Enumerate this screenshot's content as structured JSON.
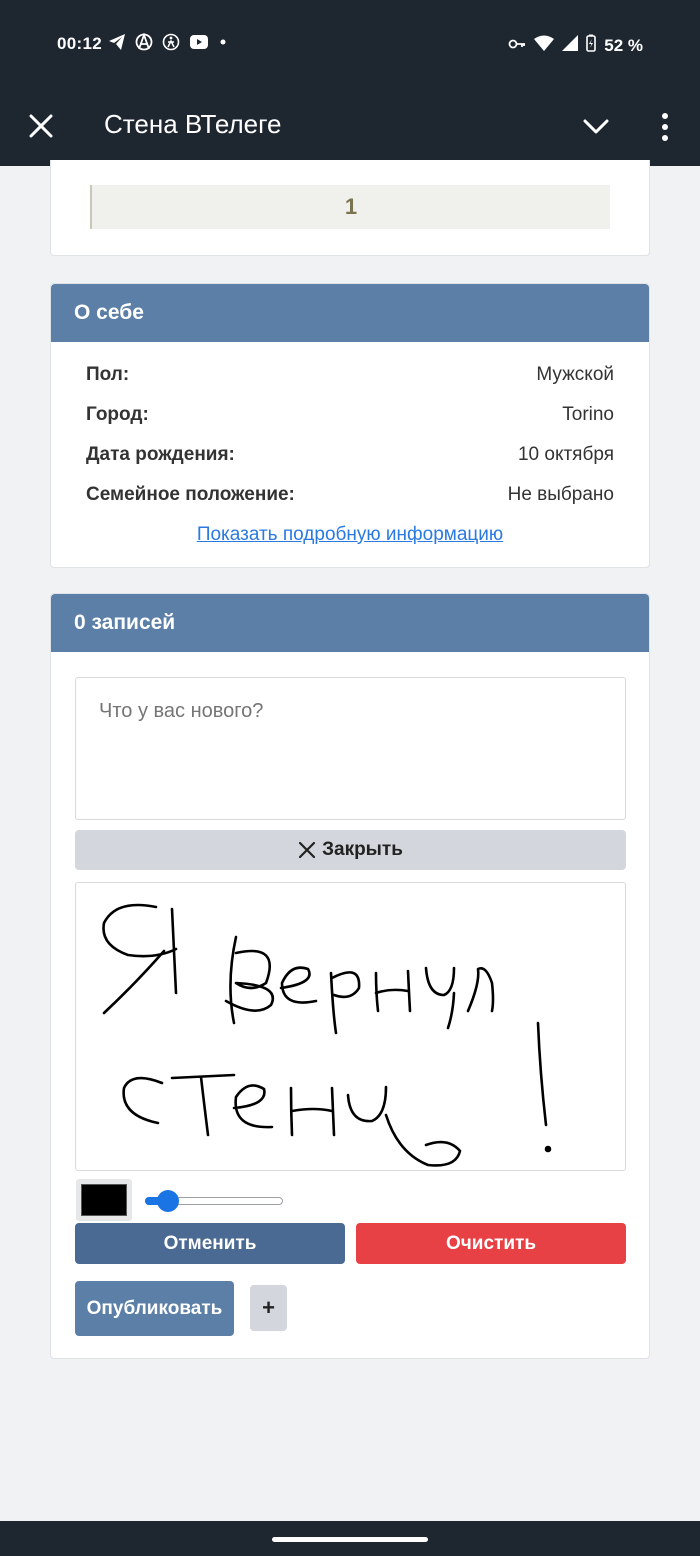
{
  "status_bar": {
    "time": "00:12",
    "battery": "52 %",
    "left_icons": [
      "telegram-icon",
      "anarchy-icon",
      "accessibility-icon",
      "youtube-icon",
      "dot-icon"
    ],
    "right_icons": [
      "vpn-key-icon",
      "wifi-icon",
      "signal-icon",
      "battery-charging-icon"
    ]
  },
  "app_bar": {
    "title": "Стена ВТелеге"
  },
  "top_card": {
    "counter": "1"
  },
  "about": {
    "heading": "О себе",
    "rows": [
      {
        "key": "Пол:",
        "value": "Мужской"
      },
      {
        "key": "Город:",
        "value": "Torino"
      },
      {
        "key": "Дата рождения:",
        "value": "10 октября"
      },
      {
        "key": "Семейное положение:",
        "value": "Не выбрано"
      }
    ],
    "more_link": "Показать подробную информацию"
  },
  "wall": {
    "heading": "0 записей",
    "post_placeholder": "Что у вас нового?",
    "close_label": "Закрыть",
    "drawing_text": "Я вернул стену!",
    "pen_color": "#000000",
    "pen_size_fraction": 0.17,
    "undo_label": "Отменить",
    "clear_label": "Очистить",
    "publish_label": "Опубликовать",
    "plus_label": "+"
  },
  "colors": {
    "bar_bg": "#1e2630",
    "card_header": "#5b7fa6",
    "undo_btn": "#4a6a93",
    "clear_btn": "#e84145",
    "link": "#2a7ae2"
  }
}
